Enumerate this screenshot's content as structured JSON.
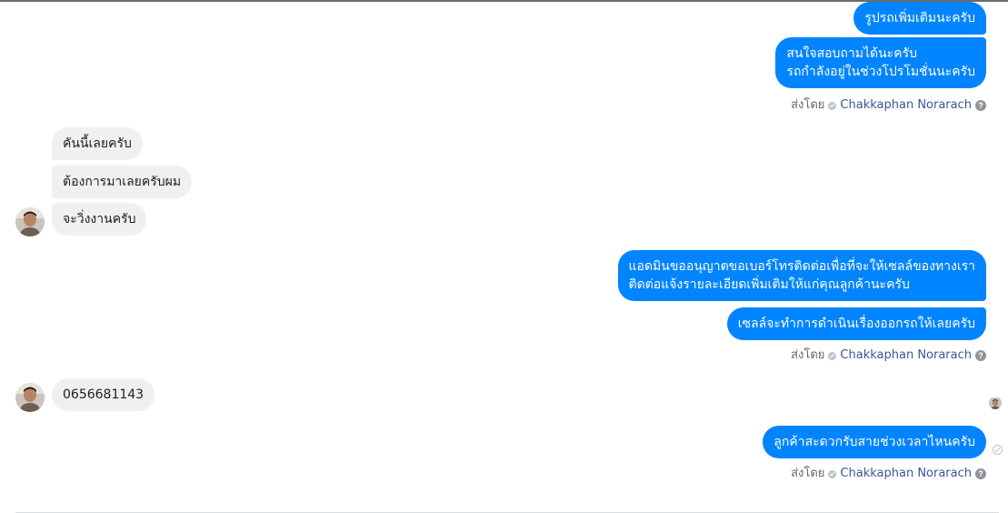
{
  "messages": {
    "out1": "รูปรถเพิ่มเติมนะครับ",
    "out2_line1": "สนใจสอบถามได้นะครับ",
    "out2_line2": "รถกำลังอยู่ในช่วงโปรโมชั่นนะครับ",
    "in1": "คันนี้เลยครับ",
    "in2": "ต้องการมาเลยครับผม",
    "in3": "จะวิ่งงานครับ",
    "out3_line1": "แอดมินขออนุญาตขอเบอร์โทรติดต่อเพื่อที่จะให้เซลล์ของทางเรา",
    "out3_line2": "ติดต่อแจ้งรายละเอียดเพิ่มเติมให้แก่คุณลูกค้านะครับ",
    "out4": "เซลล์จะทำการดำเนินเรื่องออกรถให้เลยครับ",
    "in4": "0656681143",
    "out5": "ลูกค้าสะดวกรับสายช่วงเวลาไหนครับ"
  },
  "sent_by": {
    "prefix": "ส่งโดย",
    "name": "Chakkaphan Norarach",
    "help": "?"
  },
  "colors": {
    "outgoing_bubble": "#0084ff",
    "incoming_bubble": "#f1f0f0",
    "sender_name": "#385898"
  },
  "icons": {
    "check": "check-circle-icon",
    "help": "question-icon",
    "seen": "seen-check-icon"
  }
}
